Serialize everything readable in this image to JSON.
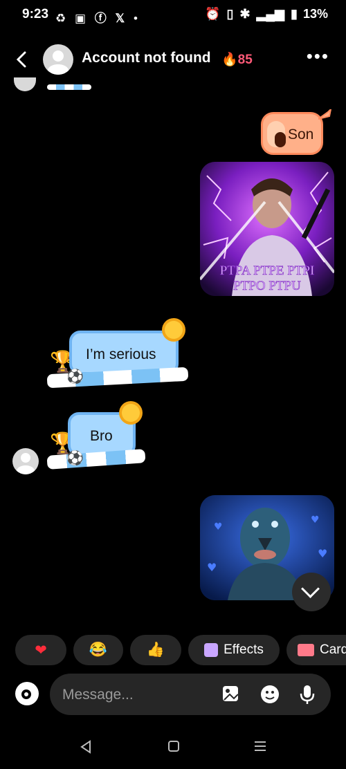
{
  "status_bar": {
    "time": "9:23",
    "right_text": "13%",
    "icons_left": [
      "sync-icon",
      "youtube-icon",
      "facebook-icon",
      "x-icon",
      "dot-icon"
    ],
    "icons_right": [
      "alarm-icon",
      "vibrate-icon",
      "bluetooth-icon",
      "4g-signal-icon",
      "battery-icon"
    ]
  },
  "header": {
    "title": "Account not found",
    "streak_count": "85",
    "streak_icon": "fire-icon"
  },
  "messages": [
    {
      "side": "right",
      "type": "sticker-text",
      "text": "Son"
    },
    {
      "side": "right",
      "type": "image",
      "caption_line1": "PTPA PTPE PTPI",
      "caption_line2": "PTPO PTPU"
    },
    {
      "side": "left",
      "type": "text",
      "text": "I’m serious"
    },
    {
      "side": "left",
      "type": "text",
      "text": "Bro"
    },
    {
      "side": "right",
      "type": "image"
    }
  ],
  "quick_reactions": [
    {
      "icon": "heart-icon",
      "label": ""
    },
    {
      "icon": "laughing-icon",
      "label": ""
    },
    {
      "icon": "thumbs-up-icon",
      "label": ""
    },
    {
      "icon": "effects-icon",
      "label": "Effects"
    },
    {
      "icon": "gift-icon",
      "label": "Card"
    }
  ],
  "composer": {
    "placeholder": "Message..."
  },
  "colors": {
    "bubble_blue": "#a7d8ff",
    "bubble_border": "#6fb4f2",
    "son_bubble": "#ffb089",
    "streak": "#ff5a78"
  }
}
